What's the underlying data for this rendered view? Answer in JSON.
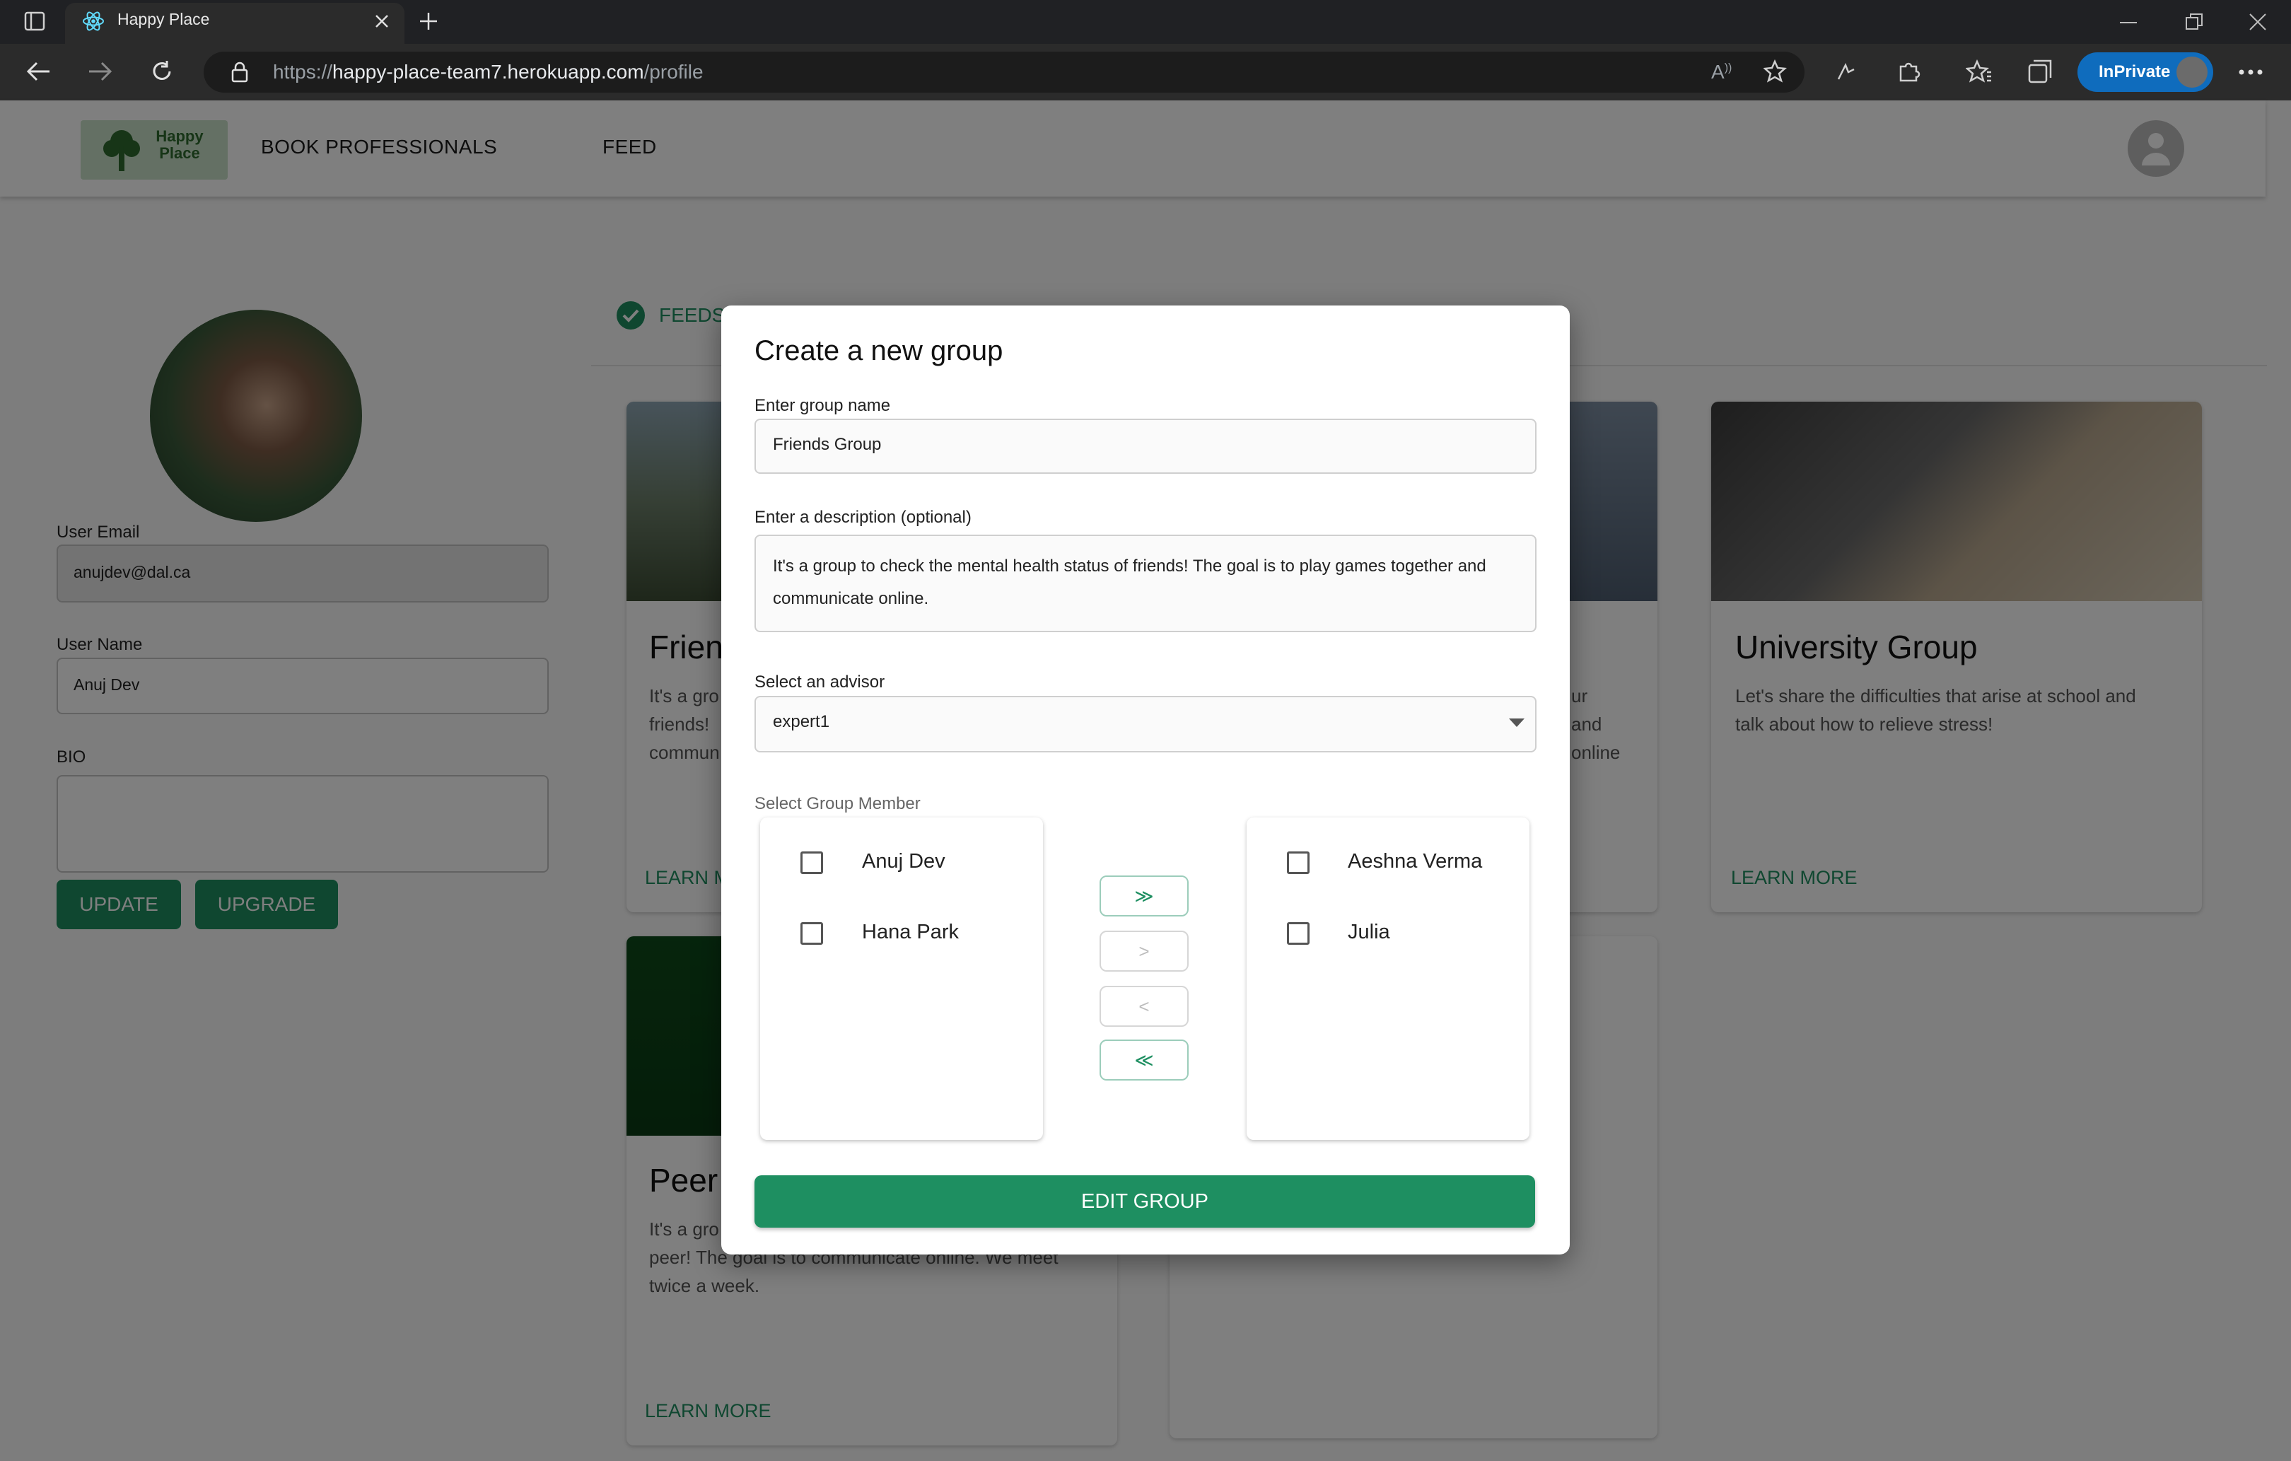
{
  "browser": {
    "tab_title": "Happy Place",
    "url_prefix": "https://",
    "url_host": "happy-place-team7.herokuapp.com",
    "url_path": "/profile",
    "inprivate_label": "InPrivate"
  },
  "app": {
    "logo_text": "Happy Place",
    "nav": [
      "BOOK PROFESSIONALS",
      "FEED"
    ]
  },
  "profile": {
    "email_label": "User Email",
    "email_value": "anujdev@dal.ca",
    "name_label": "User Name",
    "name_value": "Anuj Dev",
    "bio_label": "BIO",
    "bio_value": "",
    "update_label": "UPDATE",
    "upgrade_label": "UPGRADE"
  },
  "tabs": {
    "feeds_label": "FEEDS"
  },
  "cards": [
    {
      "title": "Frien",
      "desc_lines": [
        "It's a gro",
        "friends! ",
        "commun"
      ],
      "link": "LEARN M"
    },
    {
      "title": "",
      "desc_lines": [
        "ur",
        "and",
        "online"
      ],
      "link": ""
    },
    {
      "title": "University Group",
      "desc_lines": [
        "Let's share the difficulties that arise at school and",
        "talk about how to relieve stress!"
      ],
      "link": "LEARN MORE"
    },
    {
      "title": "Peer",
      "desc_lines": [
        "It's a gro",
        "peer! The goal is to communicate online. We meet",
        "twice a week."
      ],
      "link": "LEARN MORE"
    }
  ],
  "modal": {
    "title": "Create a new group",
    "group_name_label": "Enter group name",
    "group_name_value": "Friends Group",
    "description_label": "Enter a description (optional)",
    "description_line1": "It's a group to check the mental health status of friends! The goal is to play games together and",
    "description_line2": "communicate online.",
    "advisor_label": "Select an advisor",
    "advisor_value": "expert1",
    "members_label": "Select Group Member",
    "left_members": [
      "Anuj Dev",
      "Hana Park"
    ],
    "right_members": [
      "Aeshna Verma",
      "Julia"
    ],
    "move_buttons": [
      "≫",
      ">",
      "<",
      "≪"
    ],
    "submit_label": "EDIT GROUP"
  }
}
